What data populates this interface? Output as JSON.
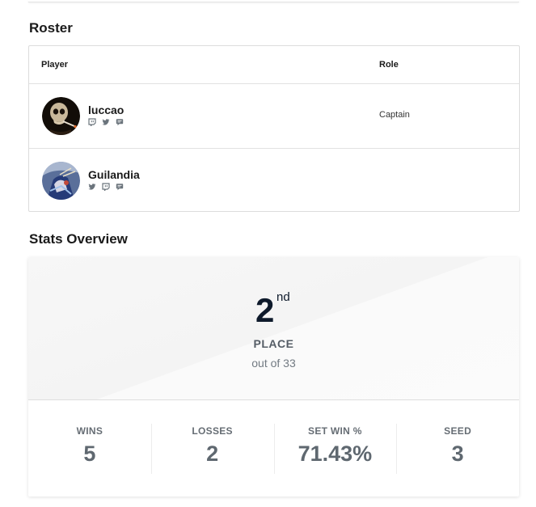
{
  "roster": {
    "title": "Roster",
    "columns": {
      "player": "Player",
      "role": "Role"
    },
    "players": [
      {
        "name": "luccao",
        "role": "Captain",
        "socials": [
          "twitch-icon",
          "twitter-icon",
          "chat-icon"
        ]
      },
      {
        "name": "Guilandia",
        "role": "",
        "socials": [
          "twitter-icon",
          "twitch-icon",
          "chat-icon"
        ]
      }
    ]
  },
  "stats": {
    "title": "Stats Overview",
    "place": {
      "number": "2",
      "suffix": "nd",
      "label": "PLACE",
      "out_of": "out of 33"
    },
    "items": [
      {
        "label": "WINS",
        "value": "5"
      },
      {
        "label": "LOSSES",
        "value": "2"
      },
      {
        "label": "SET WIN %",
        "value": "71.43%"
      },
      {
        "label": "SEED",
        "value": "3"
      }
    ]
  },
  "colors": {
    "stat_value": "#5f6870",
    "place_number": "#0e1a2b"
  }
}
